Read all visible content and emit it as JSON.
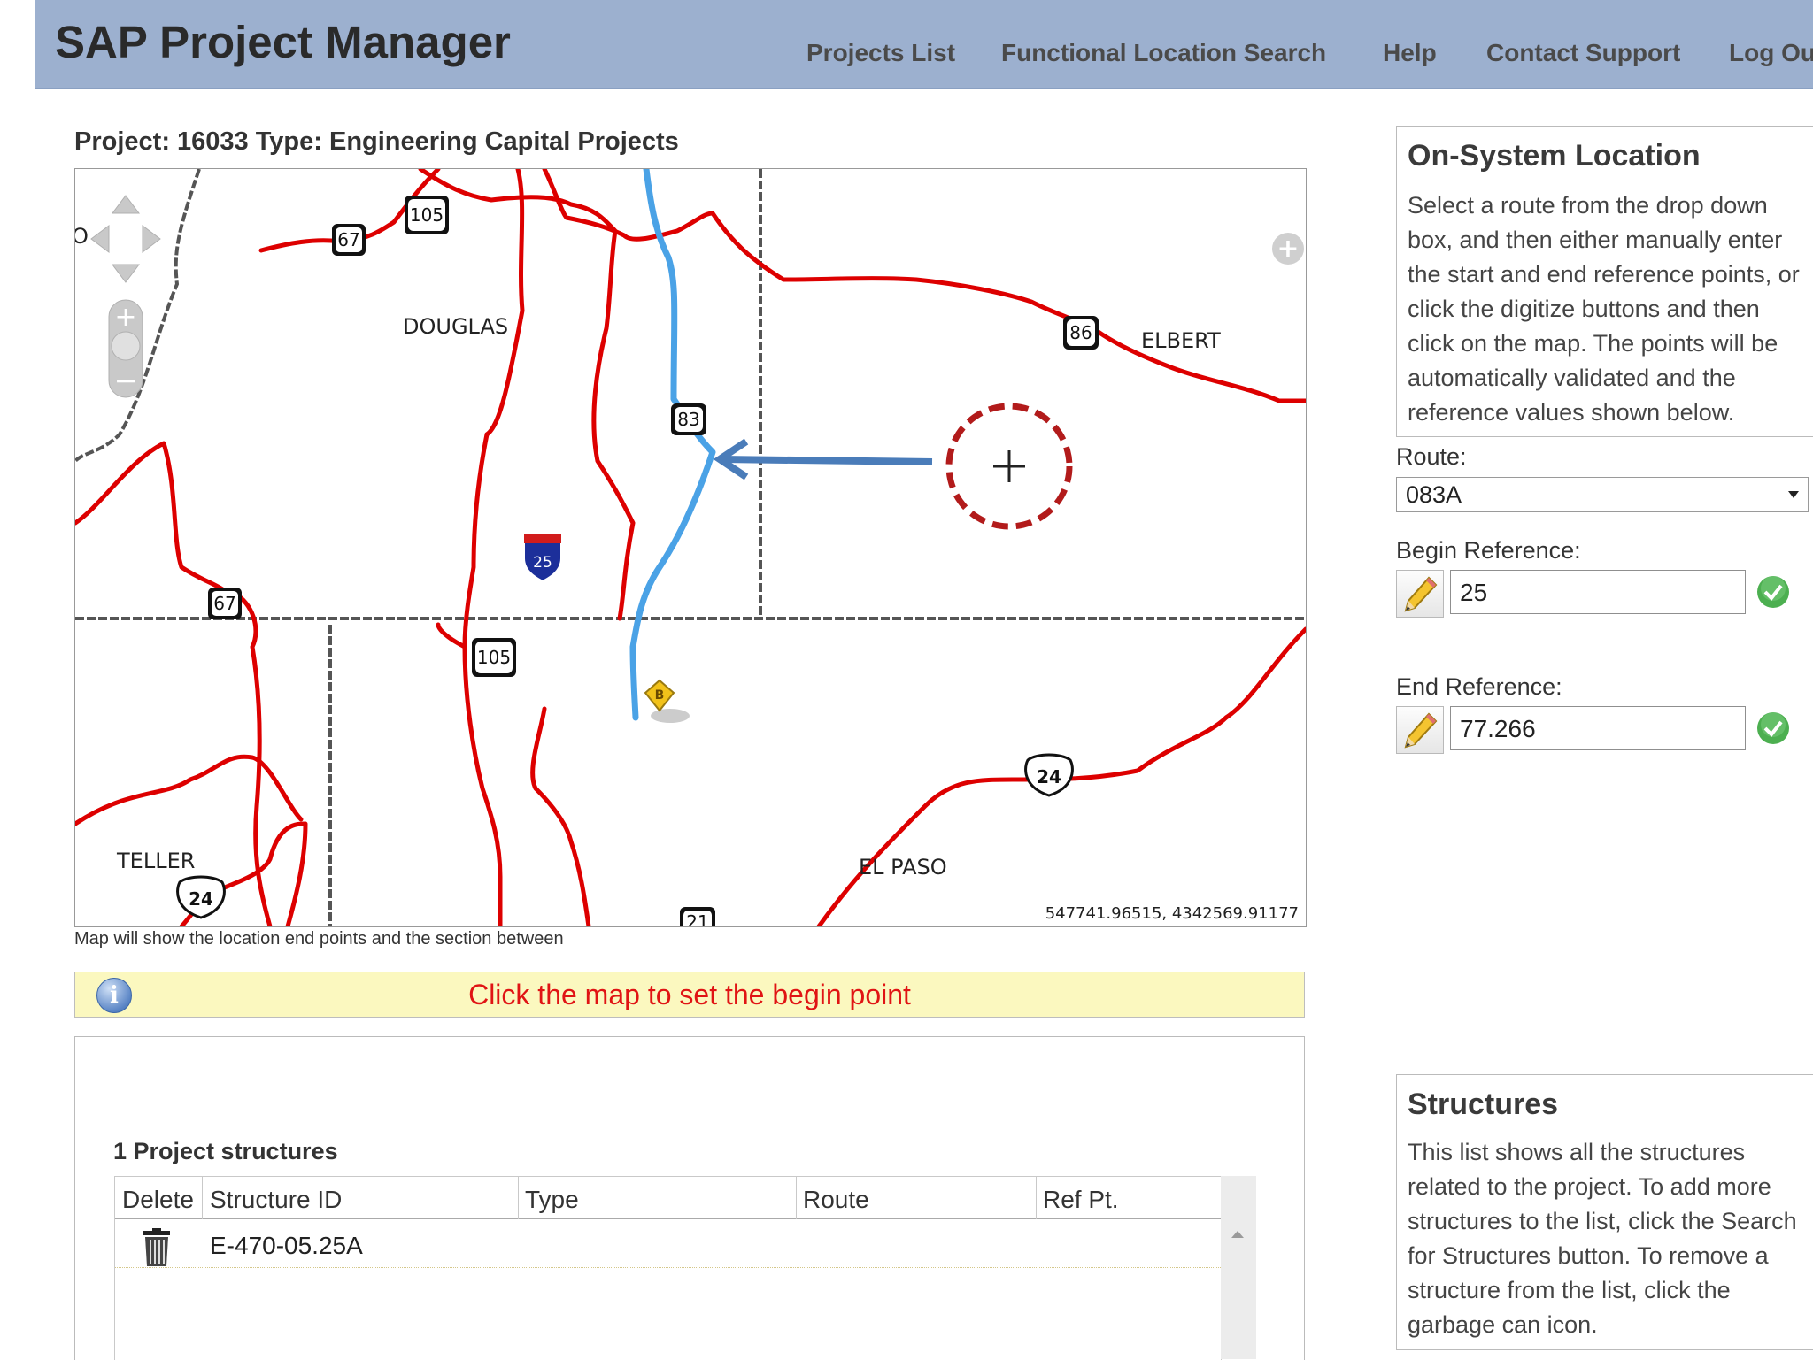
{
  "header": {
    "app_title": "SAP Project Manager",
    "nav": [
      "Projects List",
      "Functional Location Search",
      "Help",
      "Contact Support",
      "Log Ou"
    ]
  },
  "project": {
    "title": "Project: 16033 Type: Engineering Capital Projects"
  },
  "map": {
    "labels": {
      "douglas": "DOUGLAS",
      "elbert": "ELBERT",
      "teller": "TELLER",
      "el_paso": "EL PASO",
      "left_edge": "O"
    },
    "route_shields": {
      "hwy_67_north": "67",
      "hwy_105_north": "105",
      "hwy_86": "86",
      "hwy_83": "83",
      "interstate_25": "25",
      "hwy_67_south": "67",
      "hwy_105_south": "105",
      "us_24_east": "24",
      "us_24_west": "24",
      "hwy_21": "21"
    },
    "marker_letter": "B",
    "coords": "547741.96515, 4342569.91177",
    "caption": "Map will show the location end points and the section between",
    "colors": {
      "roads": "#dd0000",
      "route": "#4aa2e6",
      "crosshair": "#b21b1b",
      "arrow": "#4a7cb9"
    }
  },
  "instruction": {
    "icon": "info-icon",
    "text": "Click the map to set the begin point"
  },
  "structures_table": {
    "count_label": "1 Project structures",
    "columns": [
      "Delete",
      "Structure ID",
      "Type",
      "Route",
      "Ref Pt."
    ],
    "rows": [
      {
        "structure_id": "E-470-05.25A",
        "type": "",
        "route": "",
        "ref_pt": ""
      }
    ]
  },
  "on_system": {
    "title": "On-System Location",
    "description": "Select a route from the drop down box, and then either manually enter the start and end reference points, or click the digitize buttons and then click on the map. The points will be automatically validated and the reference values shown below.",
    "route_label": "Route:",
    "route_value": "083A",
    "begin_label": "Begin Reference:",
    "begin_value": "25",
    "end_label": "End Reference:",
    "end_value": "77.266"
  },
  "structures_help": {
    "title": "Structures",
    "description": "This list shows all the structures related to the project. To add more structures to the list, click the Search for Structures button. To remove a structure from the list, click the garbage can icon."
  }
}
